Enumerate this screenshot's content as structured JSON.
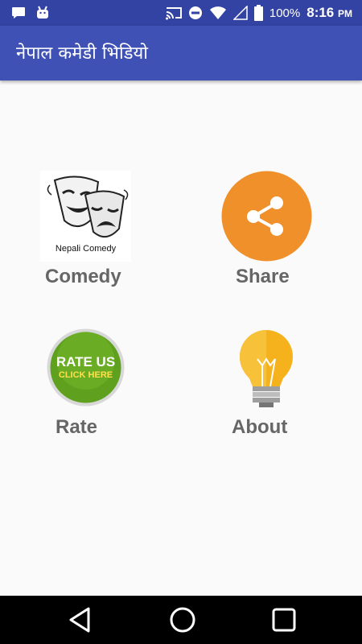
{
  "status_bar": {
    "left_icons": [
      "chat-notification-icon",
      "android-icon"
    ],
    "right_icons": [
      "cast-icon",
      "do-not-disturb-icon",
      "wifi-icon",
      "signal-icon",
      "battery-icon"
    ],
    "battery": "100%",
    "time": "8:16",
    "ampm": "PM"
  },
  "app_bar": {
    "title": "नेपाल कमेडी भिडियो",
    "color": "#3f51b5"
  },
  "grid": {
    "comedy": {
      "label": "Comedy",
      "image_caption": "Nepali Comedy"
    },
    "share": {
      "label": "Share",
      "color": "#f0902a"
    },
    "rate": {
      "label": "Rate",
      "badge_line1": "RATE US",
      "badge_line2": "CLICK HERE",
      "color": "#5fa01e"
    },
    "about": {
      "label": "About",
      "color": "#f5b21c"
    }
  },
  "nav_bar": {
    "buttons": [
      "back-icon",
      "home-icon",
      "recents-icon"
    ]
  }
}
